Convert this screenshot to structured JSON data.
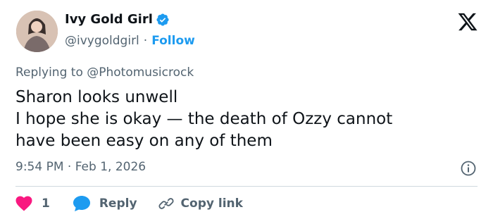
{
  "author": {
    "display_name": "Ivy Gold Girl",
    "handle": "@ivygoldgirl",
    "separator": "·",
    "follow_label": "Follow"
  },
  "reply_context": {
    "prefix": "Replying to ",
    "mention": "@Photomusicrock"
  },
  "tweet": {
    "lines": [
      "Sharon looks unwell",
      "I hope she is okay — the death of Ozzy cannot",
      "have been easy on any of them"
    ],
    "timestamp": "9:54 PM · Feb 1, 2026"
  },
  "actions": {
    "like_count": "1",
    "reply_label": "Reply",
    "copy_label": "Copy link"
  },
  "colors": {
    "accent": "#1d9bf0",
    "like": "#f91880",
    "muted": "#536471",
    "text": "#0f1419"
  },
  "icons": [
    "x-logo-icon",
    "verified-badge-icon",
    "info-icon",
    "heart-icon",
    "reply-bubble-icon",
    "link-icon"
  ]
}
